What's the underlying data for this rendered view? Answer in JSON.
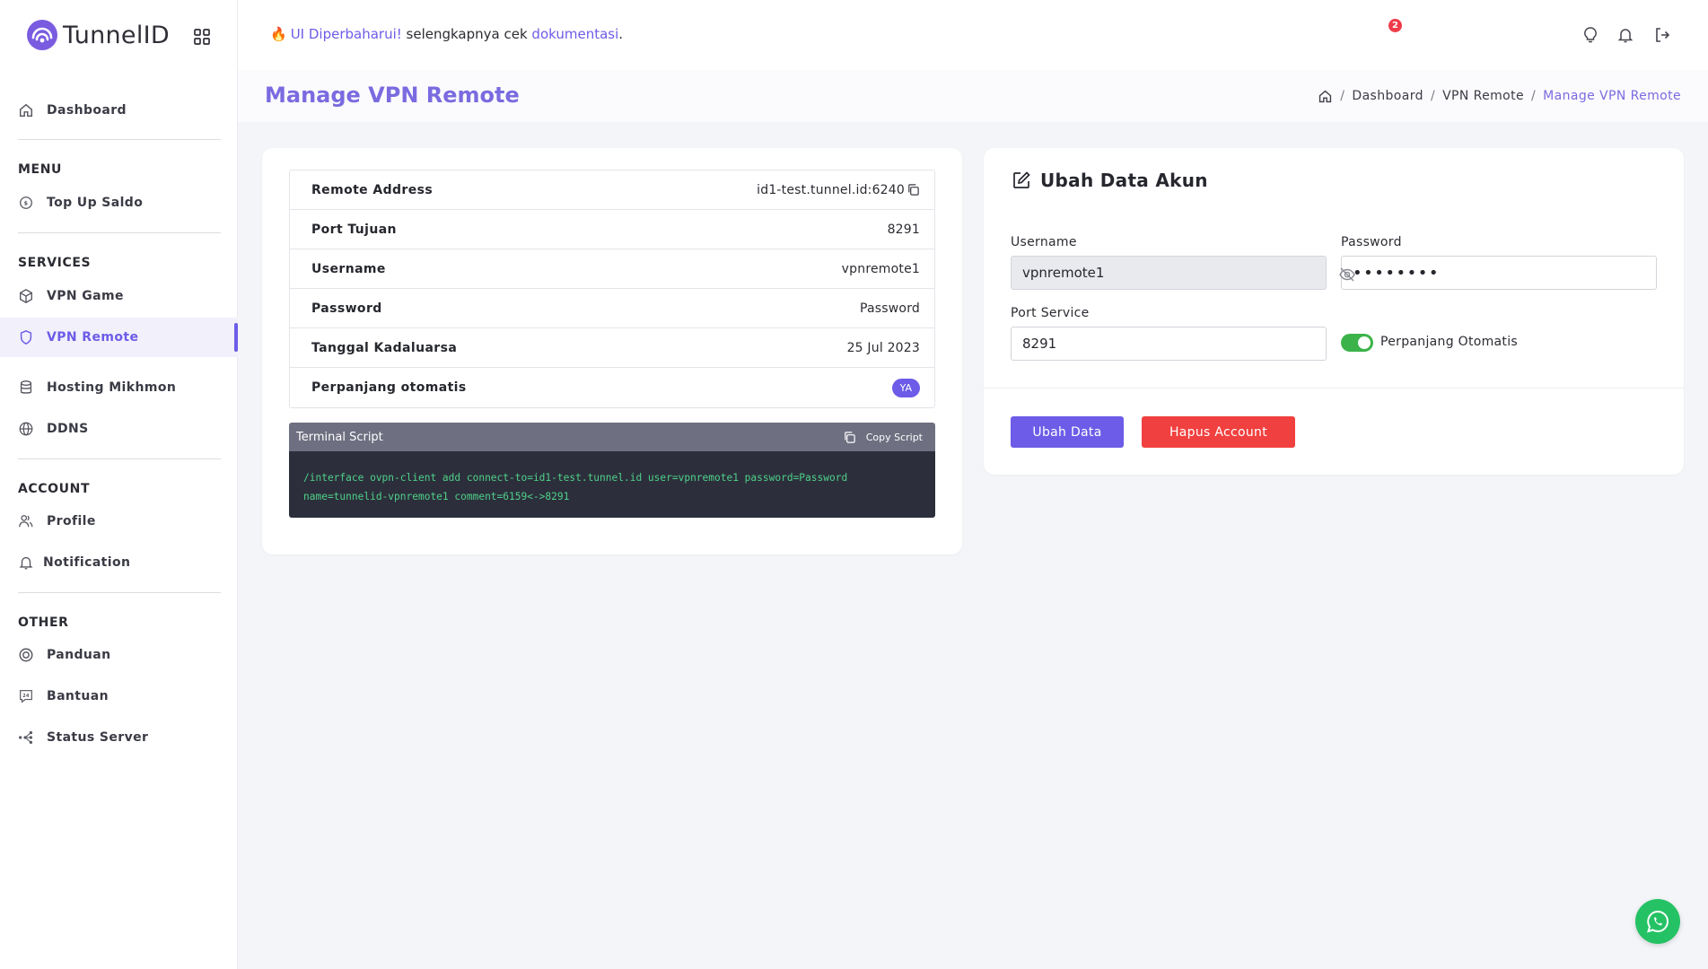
{
  "brand": {
    "name": "TunnelID"
  },
  "sidebar": {
    "dashboard": "Dashboard",
    "sections": {
      "menu": "MENU",
      "services": "SERVICES",
      "account": "ACCOUNT",
      "other": "OTHER"
    },
    "items": {
      "top_up": "Top Up Saldo",
      "vpn_game": "VPN Game",
      "vpn_remote": "VPN Remote",
      "hosting": "Hosting Mikhmon",
      "ddns": "DDNS",
      "profile": "Profile",
      "notification": "Notification",
      "panduan": "Panduan",
      "bantuan": "Bantuan",
      "status_server": "Status Server"
    },
    "active_item": "VPN Remote"
  },
  "topbar": {
    "announce_link": "UI Diperbaharui!",
    "announce_text": " selengkapnya cek ",
    "announce_doc": "dokumentasi",
    "announce_end": ".",
    "notification_count": "2"
  },
  "page": {
    "title": "Manage VPN Remote",
    "breadcrumb": [
      "Dashboard",
      "VPN Remote",
      "Manage VPN Remote"
    ]
  },
  "info": {
    "rows": [
      {
        "key": "Remote Address",
        "value": "id1-test.tunnel.id:6240"
      },
      {
        "key": "Port Tujuan",
        "value": "8291"
      },
      {
        "key": "Username",
        "value": "vpnremote1"
      },
      {
        "key": "Password",
        "value": "Password"
      },
      {
        "key": "Tanggal Kadaluarsa",
        "value": "25 Jul 2023"
      },
      {
        "key": "Perpanjang otomatis",
        "value": "YA"
      }
    ]
  },
  "terminal": {
    "title": "Terminal Script",
    "copy_label": "Copy Script",
    "line1": "/interface ovpn-client add connect-to=id1-test.tunnel.id user=vpnremote1 password=Password",
    "line2": "name=tunnelid-vpnremote1 comment=6159<->8291"
  },
  "form": {
    "title": "Ubah Data Akun",
    "username_label": "Username",
    "username_value": "vpnremote1",
    "password_label": "Password",
    "password_value": "••••••••",
    "port_label": "Port Service",
    "port_value": "8291",
    "auto_renew_label": "Perpanjang Otomatis",
    "auto_renew_on": true,
    "submit_label": "Ubah Data",
    "delete_label": "Hapus Account"
  },
  "colors": {
    "accent": "#6c5ce7",
    "danger": "#f0403f",
    "success": "#3cb34a",
    "terminal_text": "#4fd08a",
    "whatsapp": "#25c265"
  }
}
